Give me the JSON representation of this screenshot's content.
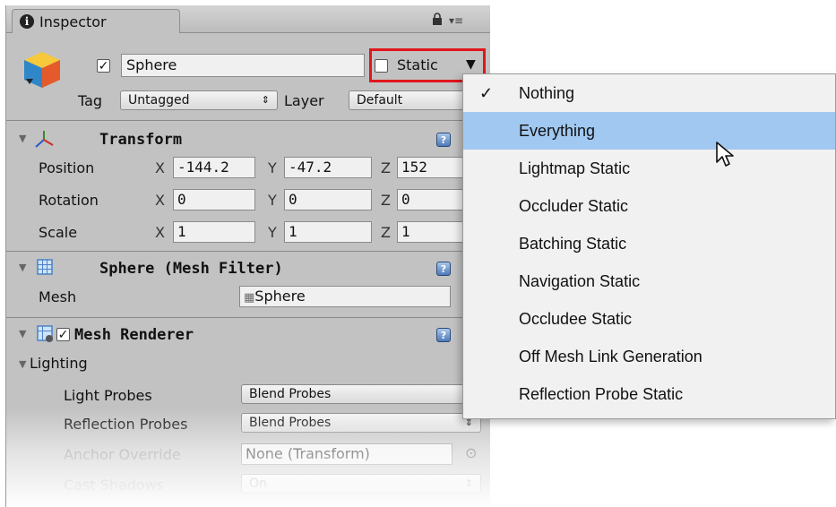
{
  "window": {
    "tab_label": "Inspector",
    "icons": {
      "tab": "info-icon",
      "lock": "lock-icon",
      "menu": "tab-menu-icon"
    }
  },
  "object": {
    "active": true,
    "name": "Sphere",
    "static_checked": false,
    "static_label": "Static",
    "tag_label": "Tag",
    "tag_value": "Untagged",
    "layer_label": "Layer",
    "layer_value": "Default"
  },
  "transform": {
    "title": "Transform",
    "position_label": "Position",
    "rotation_label": "Rotation",
    "scale_label": "Scale",
    "axis_x": "X",
    "axis_y": "Y",
    "axis_z": "Z",
    "position": {
      "x": "-144.2",
      "y": "-47.2",
      "z": "152"
    },
    "rotation": {
      "x": "0",
      "y": "0",
      "z": "0"
    },
    "scale": {
      "x": "1",
      "y": "1",
      "z": "1"
    }
  },
  "mesh_filter": {
    "title": "Sphere (Mesh Filter)",
    "mesh_label": "Mesh",
    "mesh_value": "Sphere"
  },
  "mesh_renderer": {
    "title": "Mesh Renderer",
    "enabled": true,
    "lighting_label": "Lighting",
    "light_probes_label": "Light Probes",
    "light_probes_value": "Blend Probes",
    "reflection_probes_label": "Reflection Probes",
    "reflection_probes_value": "Blend Probes",
    "anchor_override_label": "Anchor Override",
    "anchor_override_value": "None (Transform)",
    "cast_shadows_label": "Cast Shadows",
    "cast_shadows_value": "On"
  },
  "static_menu": {
    "items": [
      {
        "label": "Nothing",
        "checked": true
      },
      {
        "label": "Everything",
        "checked": false,
        "hover": true
      },
      {
        "label": "Lightmap Static",
        "checked": false
      },
      {
        "label": "Occluder Static",
        "checked": false
      },
      {
        "label": "Batching Static",
        "checked": false
      },
      {
        "label": "Navigation Static",
        "checked": false
      },
      {
        "label": "Occludee Static",
        "checked": false
      },
      {
        "label": "Off Mesh Link Generation",
        "checked": false
      },
      {
        "label": "Reflection Probe Static",
        "checked": false
      }
    ],
    "check_mark": "✓",
    "hover_color": "#a1c8f0"
  },
  "colors": {
    "highlight_box": "#e0161c",
    "panel": "#c2c2c2"
  }
}
